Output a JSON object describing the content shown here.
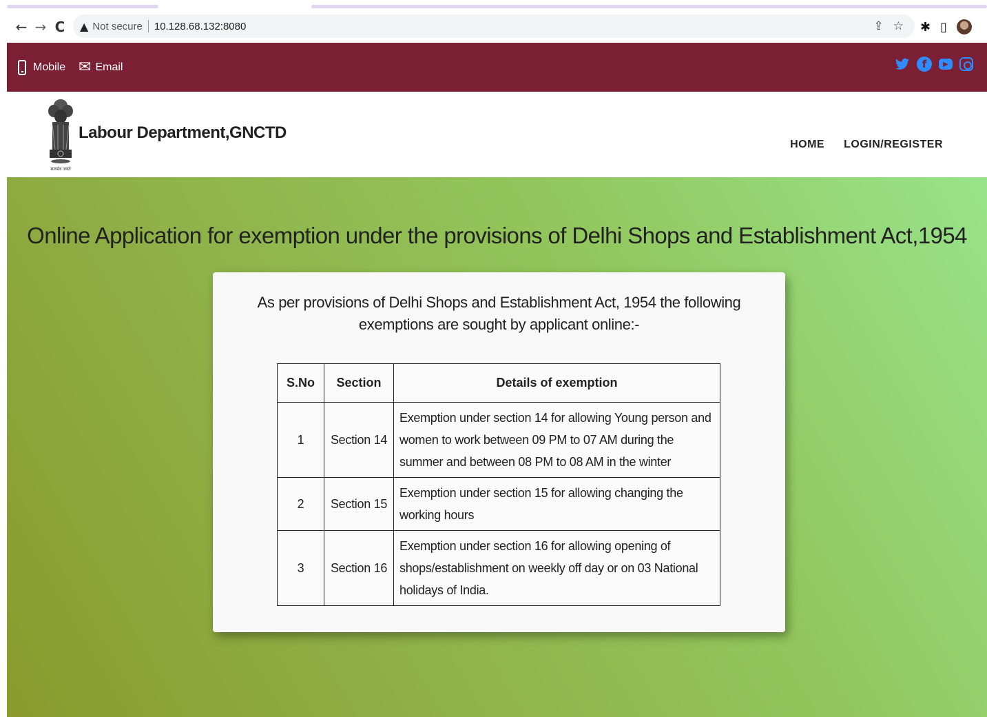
{
  "browser": {
    "not_secure_label": "Not secure",
    "url": "10.128.68.132:8080"
  },
  "topbar": {
    "mobile_label": "Mobile",
    "email_label": "Email",
    "social_icons": [
      "twitter-icon",
      "facebook-icon",
      "youtube-icon",
      "instagram-icon"
    ],
    "background": "#7b1f35",
    "social_color": "#2f8cff"
  },
  "header": {
    "brand": "Labour Department,GNCTD",
    "emblem_motto": "सत्यमेव जयते",
    "nav": {
      "home": "HOME",
      "login_register": "LOGIN/REGISTER"
    }
  },
  "hero": {
    "title": "Online Application for exemption under the provisions of Delhi Shops and Establishment Act,1954"
  },
  "card": {
    "intro": "As per provisions of Delhi Shops and Establishment Act, 1954 the following exemptions are sought by applicant online:-",
    "table": {
      "headers": [
        "S.No",
        "Section",
        "Details of exemption"
      ],
      "rows": [
        {
          "sno": "1",
          "section": "Section 14",
          "details": "Exemption under section 14 for allowing Young person and women to work between 09 PM to 07 AM during the summer and between 08 PM to 08 AM in the winter"
        },
        {
          "sno": "2",
          "section": "Section 15",
          "details": "Exemption under section 15 for allowing changing the working hours"
        },
        {
          "sno": "3",
          "section": "Section 16",
          "details": "Exemption under section 16 for allowing opening of shops/establishment on weekly off day or on 03 National holidays of India."
        }
      ]
    }
  }
}
